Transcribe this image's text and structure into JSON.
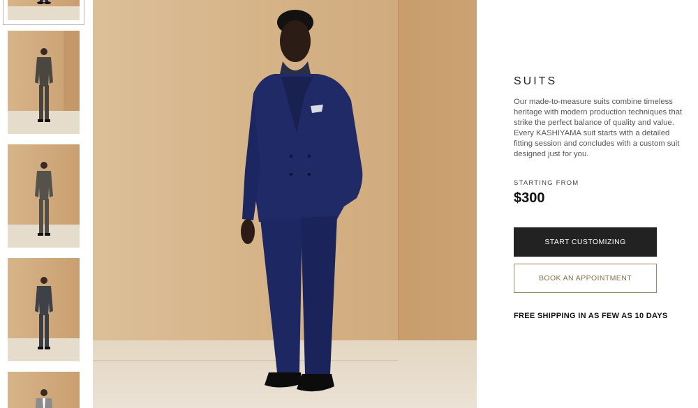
{
  "product": {
    "title": "SUITS",
    "description": "Our made-to-measure suits combine timeless heritage with modern production techniques that strike the perfect balance of quality and value. Every KASHIYAMA suit starts with a detailed fitting session and concludes with a custom suit designed just for you.",
    "starting_from_label": "STARTING FROM",
    "price": "$300",
    "primary_button": "START CUSTOMIZING",
    "secondary_button": "BOOK AN APPOINTMENT",
    "shipping_note": "FREE SHIPPING IN AS FEW AS 10 DAYS"
  },
  "colors": {
    "primary_button_bg": "#222222",
    "outline_button_text": "#8a6d4a",
    "suit_navy": "#1f2a66",
    "backdrop_tan": "#d7b68b"
  },
  "gallery": {
    "selected_index": 0,
    "thumbnails": [
      {
        "suit": "navy"
      },
      {
        "suit": "charcoal"
      },
      {
        "suit": "charcoal"
      },
      {
        "suit": "charcoal"
      },
      {
        "suit": "grey"
      }
    ]
  }
}
